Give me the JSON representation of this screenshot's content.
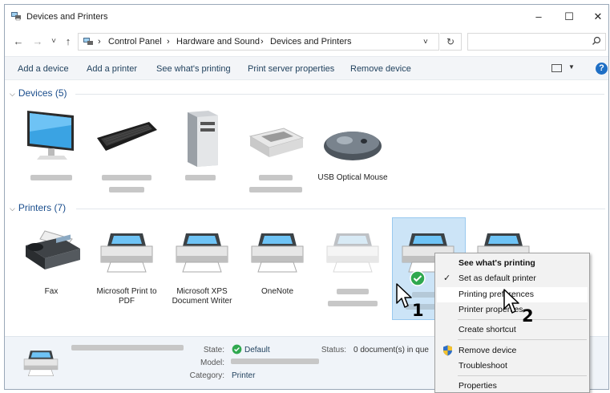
{
  "window": {
    "title": "Devices and Printers",
    "minimize": "–",
    "maximize": "☐",
    "close": "✕"
  },
  "address": {
    "back": "←",
    "forward": "→",
    "recent": "˅",
    "up": "↑",
    "crumbs": [
      "Control Panel",
      "Hardware and Sound",
      "Devices and Printers"
    ],
    "separator": "›",
    "dropdown": "˅",
    "refresh": "↻",
    "search_placeholder": ""
  },
  "commands": [
    "Add a device",
    "Add a printer",
    "See what's printing",
    "Print server properties",
    "Remove device"
  ],
  "help_label": "?",
  "devices": {
    "header": "Devices (5)",
    "items": [
      {
        "icon": "monitor-icon",
        "label": ""
      },
      {
        "icon": "keyboard-icon",
        "label": ""
      },
      {
        "icon": "computer-tower-icon",
        "label": ""
      },
      {
        "icon": "scanner-icon",
        "label": ""
      },
      {
        "icon": "mouse-icon",
        "label": "USB Optical Mouse"
      }
    ]
  },
  "printers": {
    "header": "Printers (7)",
    "items": [
      {
        "icon": "fax-icon",
        "label": "Fax"
      },
      {
        "icon": "printer-icon",
        "label": "Microsoft Print to PDF"
      },
      {
        "icon": "printer-icon",
        "label": "Microsoft XPS Document Writer"
      },
      {
        "icon": "printer-icon",
        "label": "OneNote"
      },
      {
        "icon": "printer-icon",
        "label": ""
      },
      {
        "icon": "printer-icon",
        "label": ""
      },
      {
        "icon": "printer-icon",
        "label": ""
      }
    ]
  },
  "details": {
    "state_label": "State:",
    "state_value": "Default",
    "model_label": "Model:",
    "category_label": "Category:",
    "category_value": "Printer",
    "status_label": "Status:",
    "status_value": "0 document(s) in que"
  },
  "context_menu": {
    "items": [
      "See what's printing",
      "Set as default printer",
      "Printing preferences",
      "Printer properties",
      "Create shortcut",
      "Remove device",
      "Troubleshoot",
      "Properties"
    ],
    "checked_mark": "✓"
  },
  "steps": [
    "1",
    "2"
  ],
  "colors": {
    "accent": "#1a4d8c",
    "selection": "#cce4f7",
    "default_badge": "#2fa84f"
  }
}
